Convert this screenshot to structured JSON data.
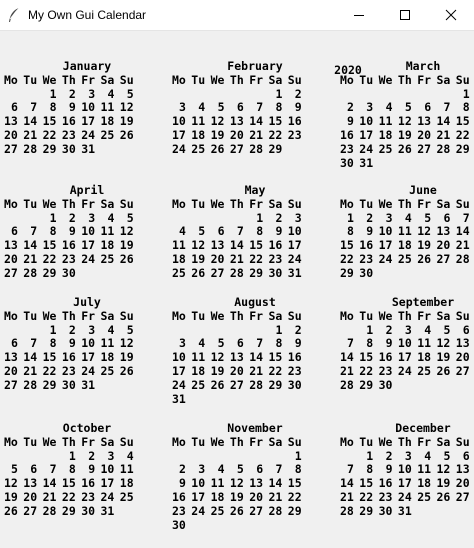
{
  "window": {
    "title": "My Own Gui Calendar",
    "icon": "feather-icon",
    "controls": [
      "minimize-icon",
      "maximize-icon",
      "close-icon"
    ]
  },
  "calendar": {
    "year": "2020",
    "weekday_labels": [
      "Mo",
      "Tu",
      "We",
      "Th",
      "Fr",
      "Sa",
      "Su"
    ],
    "months": [
      {
        "name": "January",
        "weeks": [
          [
            "",
            "",
            "1",
            "2",
            "3",
            "4",
            "5"
          ],
          [
            "6",
            "7",
            "8",
            "9",
            "10",
            "11",
            "12"
          ],
          [
            "13",
            "14",
            "15",
            "16",
            "17",
            "18",
            "19"
          ],
          [
            "20",
            "21",
            "22",
            "23",
            "24",
            "25",
            "26"
          ],
          [
            "27",
            "28",
            "29",
            "30",
            "31",
            "",
            ""
          ]
        ]
      },
      {
        "name": "February",
        "weeks": [
          [
            "",
            "",
            "",
            "",
            "",
            "1",
            "2"
          ],
          [
            "3",
            "4",
            "5",
            "6",
            "7",
            "8",
            "9"
          ],
          [
            "10",
            "11",
            "12",
            "13",
            "14",
            "15",
            "16"
          ],
          [
            "17",
            "18",
            "19",
            "20",
            "21",
            "22",
            "23"
          ],
          [
            "24",
            "25",
            "26",
            "27",
            "28",
            "29",
            ""
          ]
        ]
      },
      {
        "name": "March",
        "weeks": [
          [
            "",
            "",
            "",
            "",
            "",
            "",
            "1"
          ],
          [
            "2",
            "3",
            "4",
            "5",
            "6",
            "7",
            "8"
          ],
          [
            "9",
            "10",
            "11",
            "12",
            "13",
            "14",
            "15"
          ],
          [
            "16",
            "17",
            "18",
            "19",
            "20",
            "21",
            "22"
          ],
          [
            "23",
            "24",
            "25",
            "26",
            "27",
            "28",
            "29"
          ],
          [
            "30",
            "31",
            "",
            "",
            "",
            "",
            ""
          ]
        ]
      },
      {
        "name": "April",
        "weeks": [
          [
            "",
            "",
            "1",
            "2",
            "3",
            "4",
            "5"
          ],
          [
            "6",
            "7",
            "8",
            "9",
            "10",
            "11",
            "12"
          ],
          [
            "13",
            "14",
            "15",
            "16",
            "17",
            "18",
            "19"
          ],
          [
            "20",
            "21",
            "22",
            "23",
            "24",
            "25",
            "26"
          ],
          [
            "27",
            "28",
            "29",
            "30",
            "",
            "",
            ""
          ]
        ]
      },
      {
        "name": "May",
        "weeks": [
          [
            "",
            "",
            "",
            "",
            "1",
            "2",
            "3"
          ],
          [
            "4",
            "5",
            "6",
            "7",
            "8",
            "9",
            "10"
          ],
          [
            "11",
            "12",
            "13",
            "14",
            "15",
            "16",
            "17"
          ],
          [
            "18",
            "19",
            "20",
            "21",
            "22",
            "23",
            "24"
          ],
          [
            "25",
            "26",
            "27",
            "28",
            "29",
            "30",
            "31"
          ]
        ]
      },
      {
        "name": "June",
        "weeks": [
          [
            "1",
            "2",
            "3",
            "4",
            "5",
            "6",
            "7"
          ],
          [
            "8",
            "9",
            "10",
            "11",
            "12",
            "13",
            "14"
          ],
          [
            "15",
            "16",
            "17",
            "18",
            "19",
            "20",
            "21"
          ],
          [
            "22",
            "23",
            "24",
            "25",
            "26",
            "27",
            "28"
          ],
          [
            "29",
            "30",
            "",
            "",
            "",
            "",
            ""
          ]
        ]
      },
      {
        "name": "July",
        "weeks": [
          [
            "",
            "",
            "1",
            "2",
            "3",
            "4",
            "5"
          ],
          [
            "6",
            "7",
            "8",
            "9",
            "10",
            "11",
            "12"
          ],
          [
            "13",
            "14",
            "15",
            "16",
            "17",
            "18",
            "19"
          ],
          [
            "20",
            "21",
            "22",
            "23",
            "24",
            "25",
            "26"
          ],
          [
            "27",
            "28",
            "29",
            "30",
            "31",
            "",
            ""
          ]
        ]
      },
      {
        "name": "August",
        "weeks": [
          [
            "",
            "",
            "",
            "",
            "",
            "1",
            "2"
          ],
          [
            "3",
            "4",
            "5",
            "6",
            "7",
            "8",
            "9"
          ],
          [
            "10",
            "11",
            "12",
            "13",
            "14",
            "15",
            "16"
          ],
          [
            "17",
            "18",
            "19",
            "20",
            "21",
            "22",
            "23"
          ],
          [
            "24",
            "25",
            "26",
            "27",
            "28",
            "29",
            "30"
          ],
          [
            "31",
            "",
            "",
            "",
            "",
            "",
            ""
          ]
        ]
      },
      {
        "name": "September",
        "weeks": [
          [
            "",
            "1",
            "2",
            "3",
            "4",
            "5",
            "6"
          ],
          [
            "7",
            "8",
            "9",
            "10",
            "11",
            "12",
            "13"
          ],
          [
            "14",
            "15",
            "16",
            "17",
            "18",
            "19",
            "20"
          ],
          [
            "21",
            "22",
            "23",
            "24",
            "25",
            "26",
            "27"
          ],
          [
            "28",
            "29",
            "30",
            "",
            "",
            "",
            ""
          ]
        ]
      },
      {
        "name": "October",
        "weeks": [
          [
            "",
            "",
            "",
            "1",
            "2",
            "3",
            "4"
          ],
          [
            "5",
            "6",
            "7",
            "8",
            "9",
            "10",
            "11"
          ],
          [
            "12",
            "13",
            "14",
            "15",
            "16",
            "17",
            "18"
          ],
          [
            "19",
            "20",
            "21",
            "22",
            "23",
            "24",
            "25"
          ],
          [
            "26",
            "27",
            "28",
            "29",
            "30",
            "31",
            ""
          ]
        ]
      },
      {
        "name": "November",
        "weeks": [
          [
            "",
            "",
            "",
            "",
            "",
            "",
            "1"
          ],
          [
            "2",
            "3",
            "4",
            "5",
            "6",
            "7",
            "8"
          ],
          [
            "9",
            "10",
            "11",
            "12",
            "13",
            "14",
            "15"
          ],
          [
            "16",
            "17",
            "18",
            "19",
            "20",
            "21",
            "22"
          ],
          [
            "23",
            "24",
            "25",
            "26",
            "27",
            "28",
            "29"
          ],
          [
            "30",
            "",
            "",
            "",
            "",
            "",
            ""
          ]
        ]
      },
      {
        "name": "December",
        "weeks": [
          [
            "",
            "1",
            "2",
            "3",
            "4",
            "5",
            "6"
          ],
          [
            "7",
            "8",
            "9",
            "10",
            "11",
            "12",
            "13"
          ],
          [
            "14",
            "15",
            "16",
            "17",
            "18",
            "19",
            "20"
          ],
          [
            "21",
            "22",
            "23",
            "24",
            "25",
            "26",
            "27"
          ],
          [
            "28",
            "29",
            "30",
            "31",
            "",
            "",
            ""
          ]
        ]
      }
    ]
  }
}
